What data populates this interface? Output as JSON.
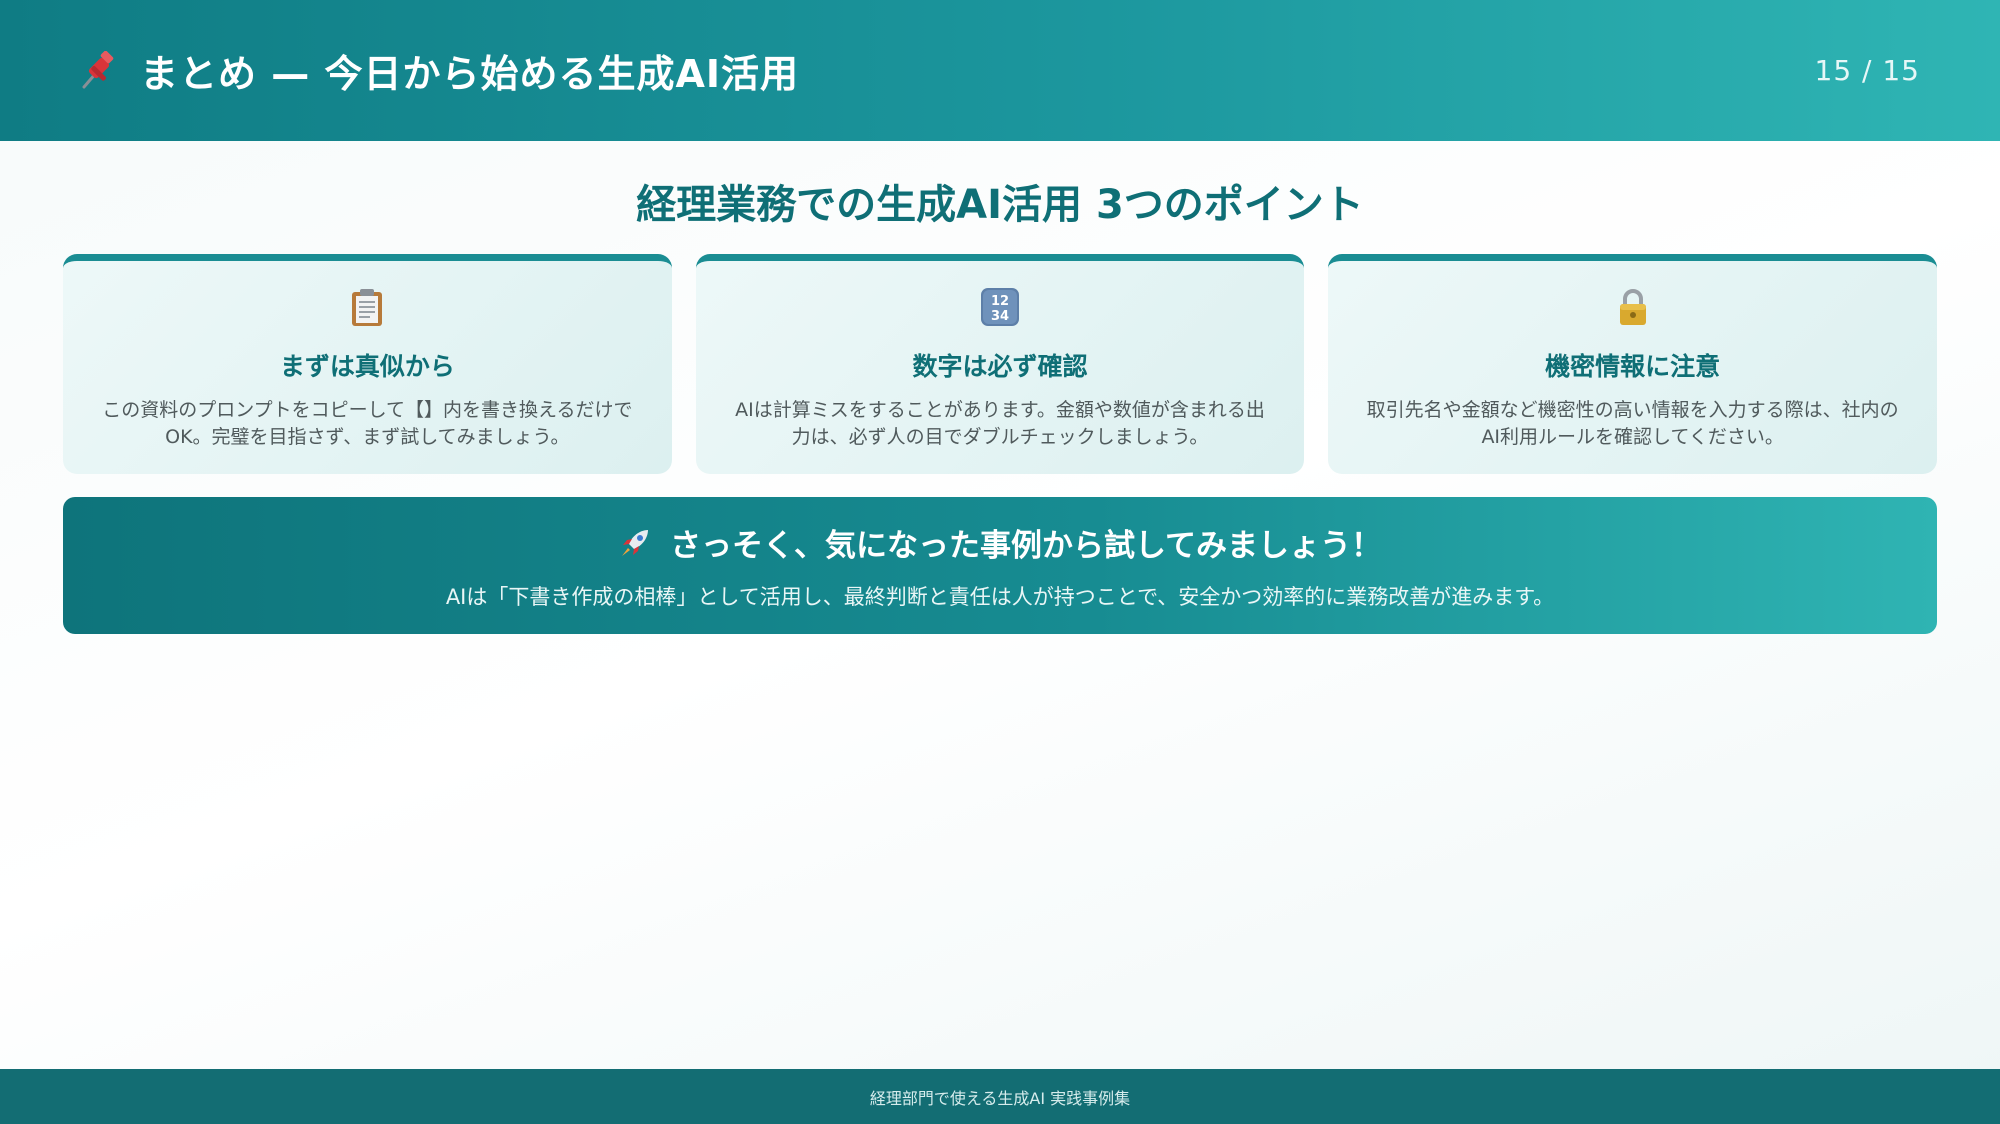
{
  "header": {
    "icon": "pushpin-icon",
    "title": "まとめ — 今日から始める生成AI活用",
    "page_indicator": "15 / 15"
  },
  "section": {
    "title": "経理業務での生成AI活用 3つのポイント"
  },
  "cards": [
    {
      "icon": "clipboard-icon",
      "title": "まずは真似から",
      "text": "この資料のプロンプトをコピーして【】内を書き換えるだけでOK。完璧を目指さず、まず試してみましょう。"
    },
    {
      "icon": "numbers-1234-icon",
      "title": "数字は必ず確認",
      "text": "AIは計算ミスをすることがあります。金額や数値が含まれる出力は、必ず人の目でダブルチェックしましょう。"
    },
    {
      "icon": "lock-icon",
      "title": "機密情報に注意",
      "text": "取引先名や金額など機密性の高い情報を入力する際は、社内のAI利用ルールを確認してください。"
    }
  ],
  "cta": {
    "icon": "rocket-icon",
    "title": "さっそく、気になった事例から試してみましょう！",
    "text": "AIは「下書き作成の相棒」として活用し、最終判断と責任は人が持つことで、安全かつ効率的に業務改善が進みます。"
  },
  "footer": {
    "text": "経理部門で使える生成AI 実践事例集"
  },
  "colors": {
    "primary": "#0f7c84",
    "accent": "#2fb5b4",
    "card_bg": "#e4f4f4",
    "footer_bg": "#136d73"
  }
}
